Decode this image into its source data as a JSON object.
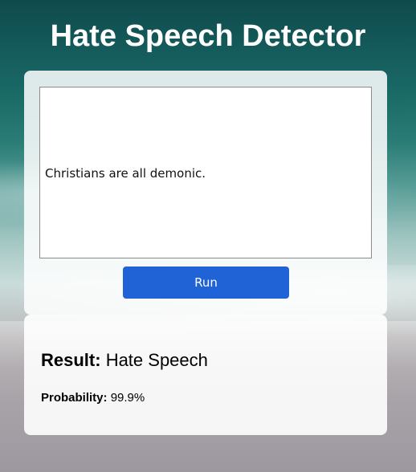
{
  "header": {
    "title": "Hate Speech Detector"
  },
  "input": {
    "value": "Christians are all demonic."
  },
  "actions": {
    "run_label": "Run"
  },
  "result": {
    "label": "Result:",
    "value": "Hate Speech",
    "probability_label": "Probability:",
    "probability_value": "99.9%"
  },
  "colors": {
    "accent": "#1f63d6",
    "title_text": "#ffffff"
  }
}
